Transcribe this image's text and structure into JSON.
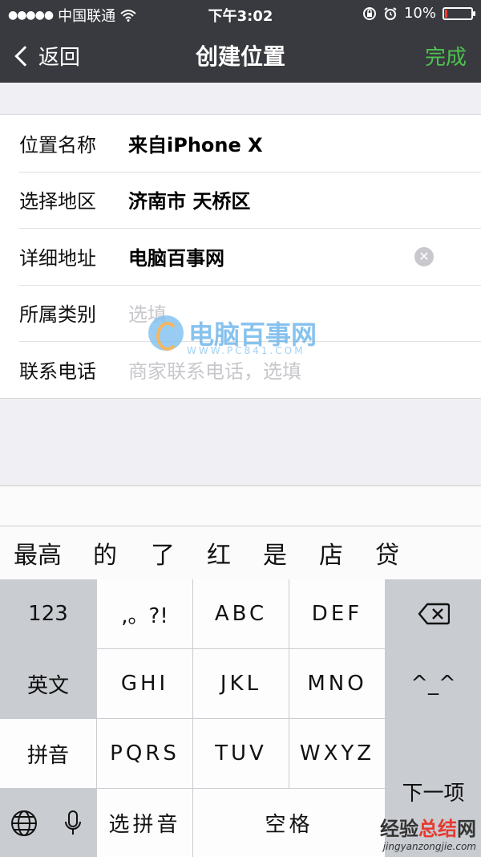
{
  "status_bar": {
    "signal_dots": "●●●●●",
    "carrier": "中国联通",
    "wifi_icon": "wifi-icon",
    "time": "下午3:02",
    "battery_percent": "10%",
    "battery_level": 0.1
  },
  "nav": {
    "back_label": "返回",
    "title": "创建位置",
    "done_label": "完成"
  },
  "form": {
    "rows": [
      {
        "label": "位置名称",
        "value": "来自iPhone X"
      },
      {
        "label": "选择地区",
        "value": "济南市 天桥区"
      },
      {
        "label": "详细地址",
        "value": "电脑百事网"
      },
      {
        "label": "所属类别",
        "placeholder": "选填"
      },
      {
        "label": "联系电话",
        "placeholder": "商家联系电话，选填"
      }
    ]
  },
  "watermark": {
    "brand": "电脑百事网",
    "url": "WWW.PC841.COM"
  },
  "candidates": [
    "最高",
    "的",
    "了",
    "红",
    "是",
    "店",
    "贷"
  ],
  "keyboard": {
    "left_keys": [
      "123",
      "英文",
      "拼音"
    ],
    "row1": [
      ",。?!",
      "ABC",
      "DEF"
    ],
    "row2": [
      "GHI",
      "JKL",
      "MNO"
    ],
    "row3": [
      "PQRS",
      "TUV",
      "WXYZ"
    ],
    "emoticon": "^_^",
    "next_item": "下一项",
    "select_pinyin": "选拼音",
    "space": "空格"
  },
  "corner_watermark": {
    "brand_black": "经验",
    "brand_red": "总结",
    "brand_suffix": "网",
    "url": "jingyanzongjie.com"
  }
}
